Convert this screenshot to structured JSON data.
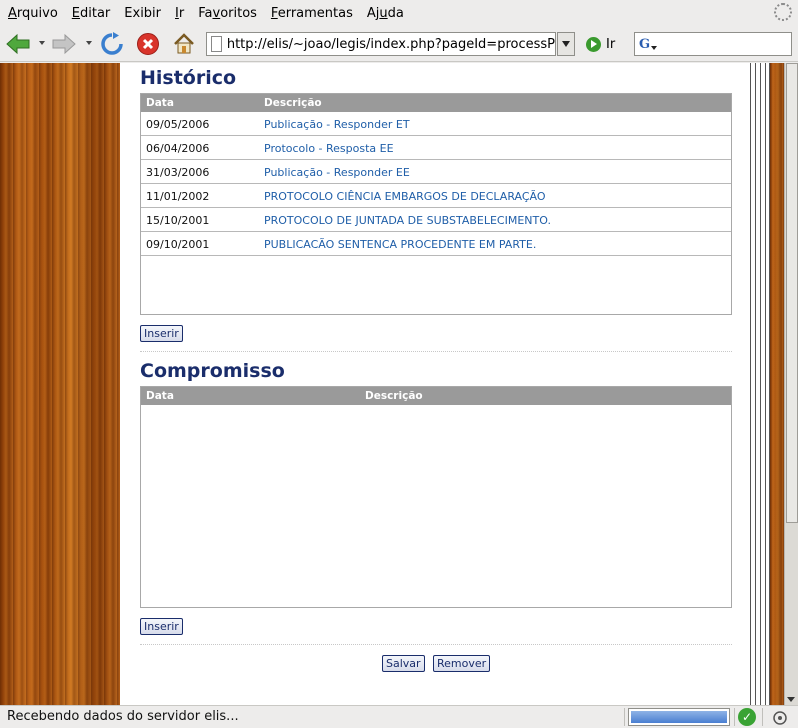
{
  "menubar": {
    "items": [
      {
        "label": "Arquivo",
        "u": "A",
        "rest": "rquivo"
      },
      {
        "label": "Editar",
        "u": "E",
        "rest": "ditar"
      },
      {
        "label": "Exibir",
        "u": "E",
        "rest": "xibir"
      },
      {
        "label": "Ir",
        "u": "I",
        "rest": "r"
      },
      {
        "label": "Favoritos",
        "pre": "Fa",
        "u": "v",
        "rest": "oritos"
      },
      {
        "label": "Ferramentas",
        "u": "F",
        "rest": "erramentas"
      },
      {
        "label": "Ajuda",
        "pre": "Aj",
        "u": "u",
        "rest": "da"
      }
    ]
  },
  "toolbar": {
    "url": "http://elis/~joao/legis/index.php?pageId=processP",
    "go_label": "Ir",
    "search_engine": "G"
  },
  "historico": {
    "title": "Histórico",
    "col_data": "Data",
    "col_desc": "Descrição",
    "rows": [
      {
        "date": "09/05/2006",
        "text": "Publicação - Responder ET"
      },
      {
        "date": "06/04/2006",
        "text": "Protocolo - Resposta EE"
      },
      {
        "date": "31/03/2006",
        "text": "Publicação - Responder EE"
      },
      {
        "date": "11/01/2002",
        "text": "PROTOCOLO CIÊNCIA EMBARGOS DE DECLARAÇÃO"
      },
      {
        "date": "15/10/2001",
        "text": "PROTOCOLO DE JUNTADA DE SUBSTABELECIMENTO."
      },
      {
        "date": "09/10/2001",
        "text": "PUBLICACÃO SENTENCA PROCEDENTE EM PARTE."
      }
    ],
    "insert_label": "Inserir"
  },
  "compromisso": {
    "title": "Compromisso",
    "col_data": "Data",
    "col_desc": "Descrição",
    "insert_label": "Inserir"
  },
  "actions": {
    "save_label": "Salvar",
    "remove_label": "Remover"
  },
  "status": {
    "message": "Recebendo dados do servidor elis...",
    "progress": 1.0
  },
  "colors": {
    "heading": "#1a2d6b",
    "link": "#1f5ea8",
    "table_header": "#9a9a9a"
  }
}
